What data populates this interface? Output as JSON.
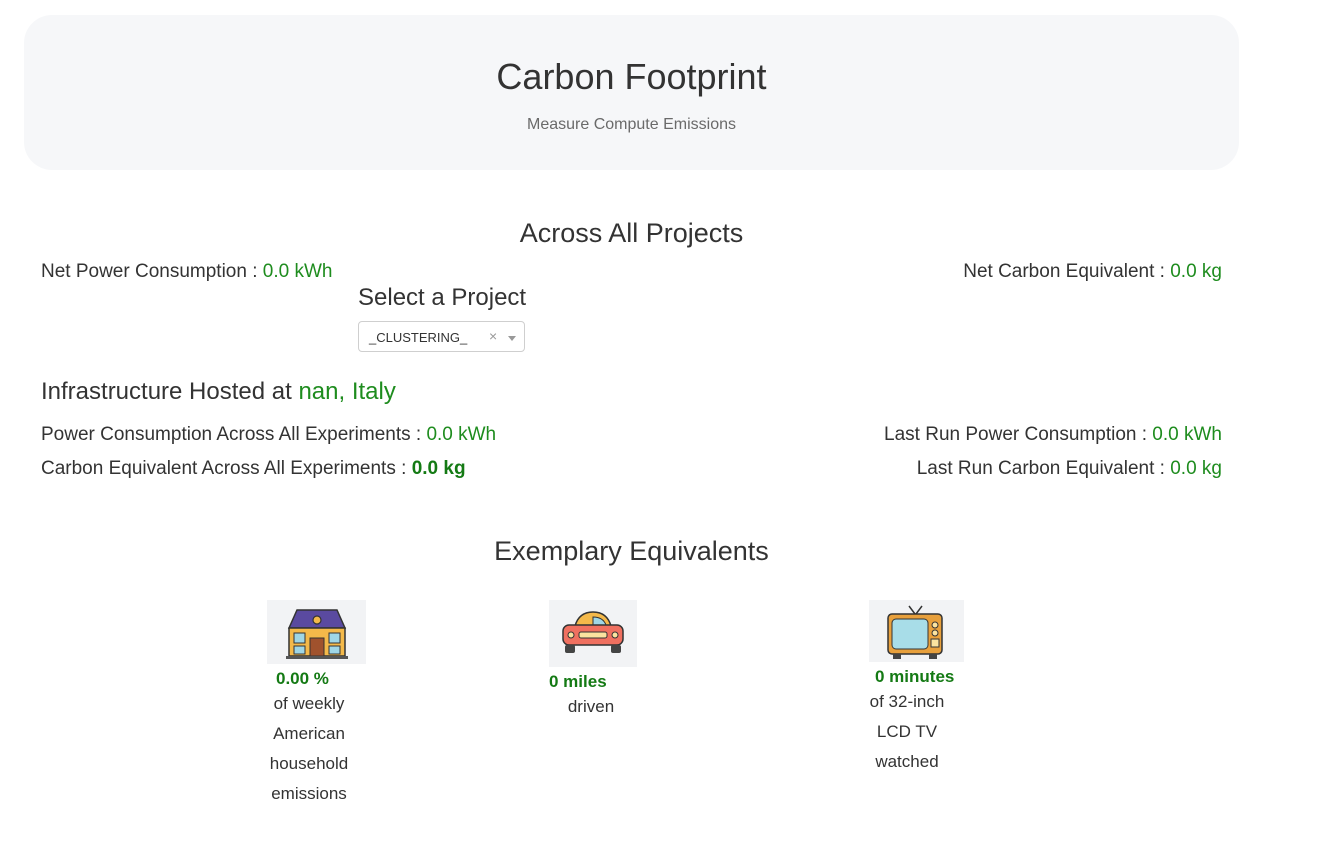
{
  "header": {
    "title": "Carbon Footprint",
    "subtitle": "Measure Compute Emissions"
  },
  "overview": {
    "title": "Across All Projects",
    "net_power_label": "Net Power Consumption : ",
    "net_power_value": "0.0 kWh",
    "net_carbon_label": "Net Carbon Equivalent : ",
    "net_carbon_value": "0.0 kg"
  },
  "project_select": {
    "label": "Select a Project",
    "selected": "_CLUSTERING_",
    "clear_symbol": "×"
  },
  "infrastructure": {
    "label": "Infrastructure Hosted at ",
    "location": "nan, Italy"
  },
  "metrics": {
    "power_all_label": "Power Consumption Across All Experiments : ",
    "power_all_value": "0.0 kWh",
    "carbon_all_label": "Carbon Equivalent Across All Experiments : ",
    "carbon_all_value": "0.0 kg",
    "last_power_label": "Last Run Power Consumption : ",
    "last_power_value": "0.0 kWh",
    "last_carbon_label": "Last Run Carbon Equivalent : ",
    "last_carbon_value": "0.0 kg"
  },
  "equivalents": {
    "title": "Exemplary Equivalents",
    "items": [
      {
        "icon": "house-icon",
        "value": "0.00 %",
        "desc_lines": [
          "of weekly",
          "American",
          "household",
          "emissions"
        ]
      },
      {
        "icon": "car-icon",
        "value": "0 miles",
        "desc_lines": [
          "driven"
        ]
      },
      {
        "icon": "tv-icon",
        "value": "0 minutes",
        "desc_lines": [
          "of 32-inch",
          "LCD TV",
          "watched"
        ]
      }
    ]
  },
  "colors": {
    "accent_green": "#1e8c1e",
    "jumbotron_bg": "#f6f7f9"
  }
}
